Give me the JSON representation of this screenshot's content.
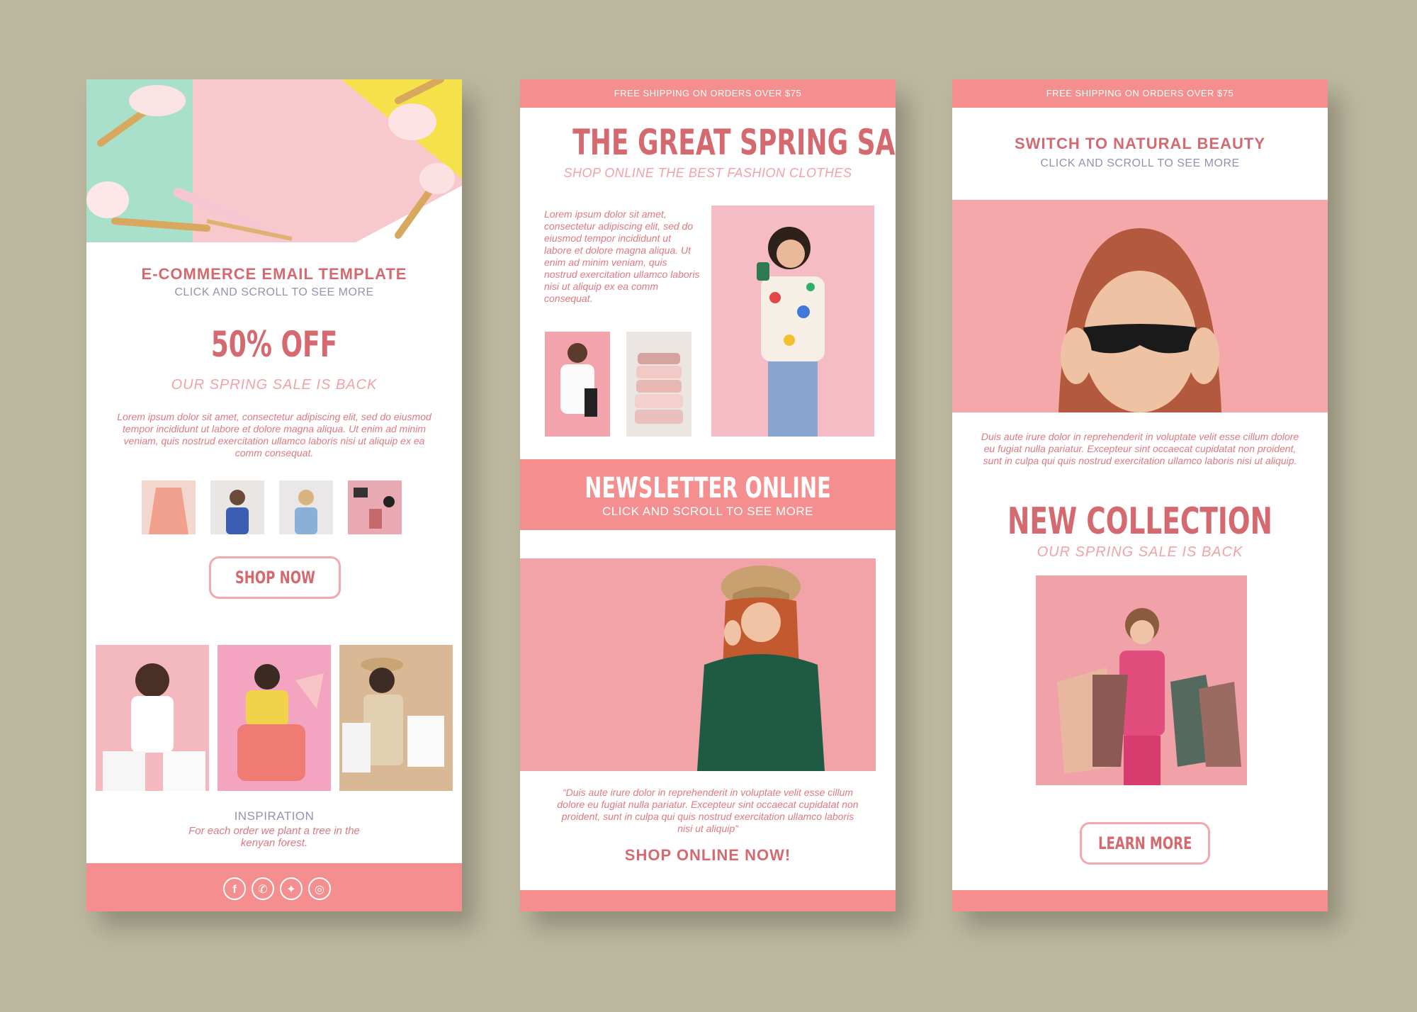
{
  "card1": {
    "title": "E-COMMERCE EMAIL TEMPLATE",
    "subtitle": "CLICK AND SCROLL TO SEE MORE",
    "discount": "50% OFF",
    "discount_sub": "OUR SPRING SALE IS BACK",
    "body": "Lorem ipsum dolor sit amet, consectetur adipiscing elit, sed do eiusmod tempor incididunt ut labore et dolore magna aliqua. Ut enim ad minim veniam, quis nostrud exercitation ullamco laboris nisi ut aliquip ex ea comm consequat.",
    "button": "SHOP NOW",
    "inspiration_title": "INSPIRATION",
    "inspiration_text": "For each order we plant a tree in the kenyan forest.",
    "social_icons": [
      "facebook-icon",
      "whatsapp-icon",
      "twitter-icon",
      "instagram-icon"
    ]
  },
  "card2": {
    "topbar": "FREE SHIPPING ON ORDERS OVER $75",
    "title": "THE GREAT SPRING SALE",
    "subtitle": "SHOP ONLINE THE BEST FASHION CLOTHES",
    "body": "Lorem ipsum dolor sit amet, consectetur adipiscing elit, sed do eiusmod tempor incididunt ut labore et dolore magna aliqua. Ut enim ad minim veniam, quis nostrud exercitation ullamco laboris nisi ut aliquip ex ea comm consequat.",
    "banner_title": "NEWSLETTER ONLINE",
    "banner_sub": "CLICK AND SCROLL TO SEE MORE",
    "quote": "“Duis aute irure dolor in reprehenderit in voluptate velit esse cillum dolore eu fugiat nulla pariatur. Excepteur sint occaecat cupidatat non proident, sunt in culpa qui quis nostrud exercitation ullamco laboris nisi ut aliquip”",
    "cta": "SHOP ONLINE NOW!"
  },
  "card3": {
    "topbar": "FREE SHIPPING ON ORDERS OVER $75",
    "title": "SWITCH TO NATURAL BEAUTY",
    "subtitle": "CLICK AND SCROLL TO SEE MORE",
    "body": "Duis aute irure dolor in reprehenderit in voluptate velit esse cillum dolore eu fugiat nulla pariatur. Excepteur sint occaecat cupidatat non proident, sunt in culpa qui quis nostrud exercitation ullamco laboris nisi ut aliquip.",
    "collection_title": "NEW COLLECTION",
    "collection_sub": "OUR SPRING SALE IS BACK",
    "button": "LEARN MORE"
  },
  "colors": {
    "background": "#bcb8a0",
    "accent": "#f58f8f",
    "title": "#d46a70",
    "subtitle": "#9a8fb0"
  }
}
